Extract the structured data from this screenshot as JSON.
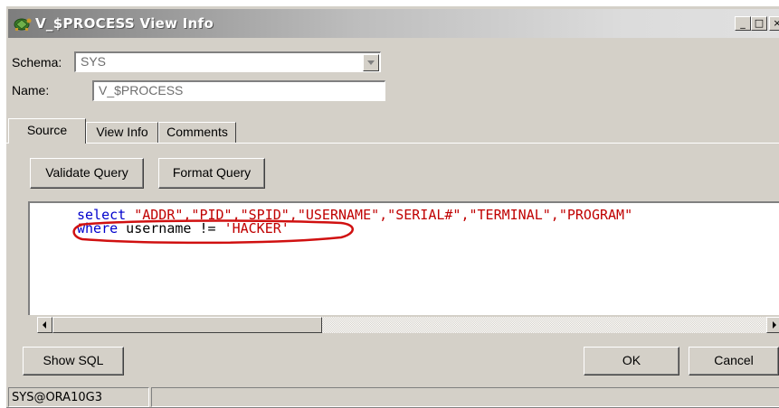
{
  "window": {
    "title": "V_$PROCESS View Info",
    "controls": {
      "minimize": "_",
      "maximize": "□",
      "close": "×"
    }
  },
  "form": {
    "schema_label": "Schema:",
    "schema_value": "SYS",
    "name_label": "Name:",
    "name_value": "V_$PROCESS"
  },
  "tabs": [
    {
      "label": "Source",
      "active": true
    },
    {
      "label": "View Info",
      "active": false
    },
    {
      "label": "Comments",
      "active": false
    }
  ],
  "toolbar": {
    "validate_label": "Validate Query",
    "format_label": "Format Query"
  },
  "editor": {
    "line1_keyword": "select",
    "line1_rest": " \"ADDR\",\"PID\",\"SPID\",\"USERNAME\",\"SERIAL#\",\"TERMINAL\",\"PROGRAM\"",
    "line2_keyword": "where",
    "line2_mid": " username != ",
    "line2_string": "'HACKER'"
  },
  "footer": {
    "show_sql_label": "Show SQL",
    "ok_label": "OK",
    "cancel_label": "Cancel"
  },
  "status": {
    "connection": "SYS@ORA10G3"
  },
  "colors": {
    "keyword": "#0000cc",
    "string": "#cc0000",
    "annotation": "#d01010"
  }
}
